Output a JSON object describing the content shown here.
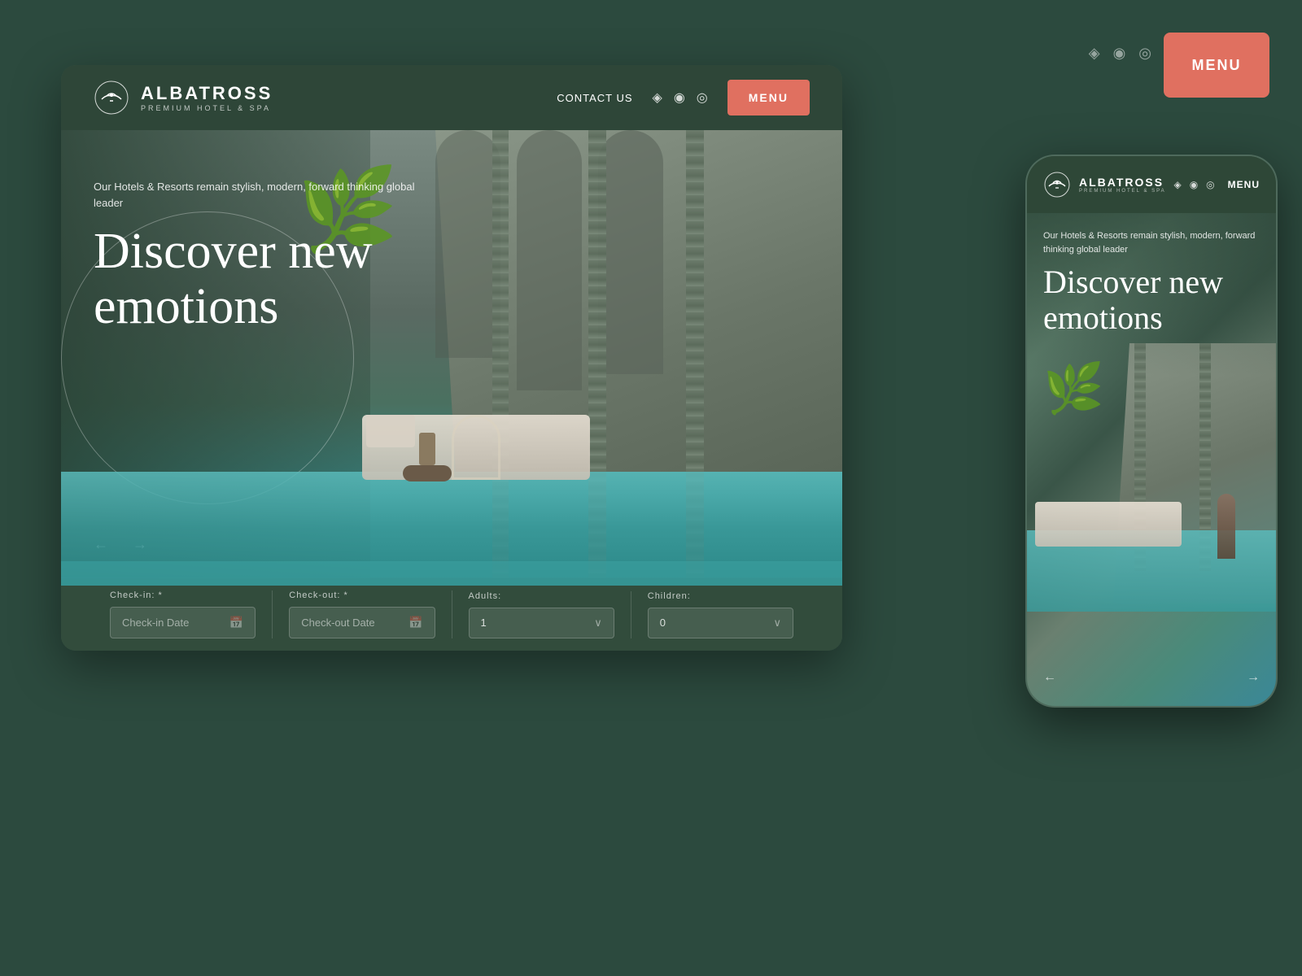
{
  "background": {
    "color": "#2d4a3e"
  },
  "topRight": {
    "menuLabel": "MENU",
    "menuColor": "#e07060"
  },
  "desktop": {
    "nav": {
      "logoName": "ALBATROSS",
      "logoSubtitle": "PREMIUM HOTEL & SPA",
      "contactLabel": "CONTACT US",
      "menuLabel": "MENU",
      "menuColor": "#e07060"
    },
    "hero": {
      "subtitle": "Our Hotels & Resorts remain stylish, modern, forward thinking global leader",
      "title": "Discover new emotions",
      "arrowLeft": "←",
      "arrowRight": "→"
    },
    "booking": {
      "checkinLabel": "Check-in: *",
      "checkinPlaceholder": "Check-in Date",
      "checkoutLabel": "Check-out: *",
      "checkoutPlaceholder": "Check-out Date",
      "adultsLabel": "Adults:",
      "adultsValue": "1",
      "childrenLabel": "Children:",
      "childrenValue": "0"
    }
  },
  "mobile": {
    "nav": {
      "logoName": "ALBATROSS",
      "logoSubtitle": "PREMIUM HOTEL & SPA",
      "menuLabel": "MENU"
    },
    "hero": {
      "subtitle": "Our Hotels & Resorts remain stylish, modern, forward thinking global leader",
      "title": "Discover new emotions",
      "arrowLeft": "←",
      "arrowRight": "→"
    }
  },
  "icons": {
    "calendar": "📅",
    "foursquare": "◈",
    "tripadvisor": "◉",
    "instagram": "◎",
    "chevronDown": "∨",
    "arrowLeft": "←",
    "arrowRight": "→"
  }
}
